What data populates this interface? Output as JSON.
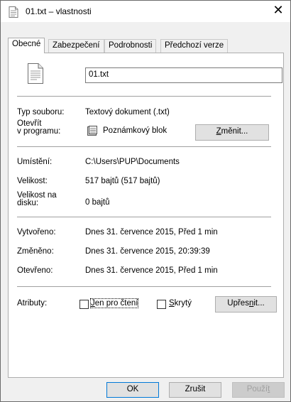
{
  "window": {
    "title": "01.txt – vlastnosti",
    "close_glyph": "✕"
  },
  "tabs": [
    {
      "label": "Obecné",
      "active": true
    },
    {
      "label": "Zabezpečení",
      "active": false
    },
    {
      "label": "Podrobnosti",
      "active": false
    },
    {
      "label": "Předchozí verze",
      "active": false
    }
  ],
  "general": {
    "file_icon": "text-file-icon",
    "file_name": "01.txt",
    "type_label": "Typ souboru:",
    "type_value": "Textový dokument (.txt)",
    "open_with_label_1": "Otevřít",
    "open_with_label_2": "v programu:",
    "open_with_icon": "notepad-icon",
    "open_with_value": "Poznámkový blok",
    "change_button_pre": "",
    "change_button_u": "Z",
    "change_button_post": "měnit...",
    "location_label": "Umístění:",
    "location_value": "C:\\Users\\PUP\\Documents",
    "size_label": "Velikost:",
    "size_value": "517 bajtů (517 bajtů)",
    "size_on_disk_label_1": "Velikost na",
    "size_on_disk_label_2": "disku:",
    "size_on_disk_value": "0 bajtů",
    "created_label": "Vytvořeno:",
    "created_value": "Dnes 31. července 2015, Před 1 min",
    "modified_label": "Změněno:",
    "modified_value": "Dnes 31. července 2015, 20:39:39",
    "accessed_label": "Otevřeno:",
    "accessed_value": "Dnes 31. července 2015, Před 1 min",
    "attributes_label": "Atributy:",
    "readonly_u": "J",
    "readonly_rest": "en pro čtení",
    "readonly_checked": false,
    "hidden_u": "S",
    "hidden_rest": "krytý",
    "hidden_checked": false,
    "advanced_pre": "Upřes",
    "advanced_u": "n",
    "advanced_post": "it..."
  },
  "footer": {
    "ok_label": "OK",
    "cancel_label": "Zrušit",
    "apply_pre": "Použí",
    "apply_u": "t",
    "apply_post": ""
  }
}
